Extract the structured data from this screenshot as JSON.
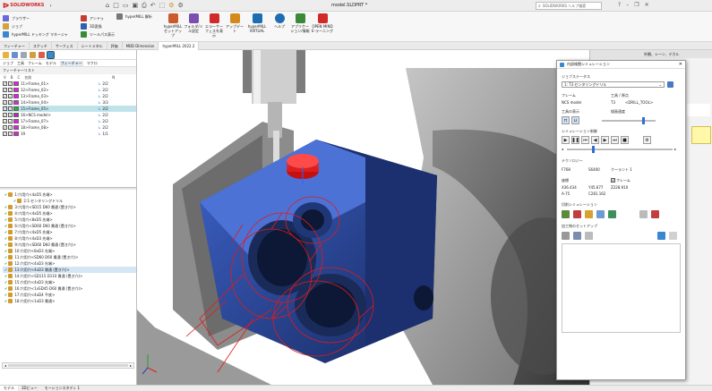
{
  "app": {
    "name": "SOLIDWORKS",
    "doc_title": "model.SLDPRT *",
    "search_placeholder": "SOLIDWORKS ヘルプ検索",
    "brand_color": "#d22027"
  },
  "quickmenu": [
    "ブラウザー",
    "ジョブ",
    "hyperMILL ドッキング マネージャ"
  ],
  "ribbon": [
    {
      "label": "アンドゥ",
      "color": "#c63b2f"
    },
    {
      "label": "3D変換",
      "color": "#2d5fb4"
    },
    {
      "label": "ツールパス表示",
      "color": "#3a8a3a"
    },
    {
      "label": "hyperMILL 解析",
      "color": "#555555"
    },
    {
      "label": "hyperMILL セットアップ",
      "color": "#cc5a2a"
    },
    {
      "label": "フォルダ/ミル設定",
      "color": "#7a4fb0"
    },
    {
      "label": "エラーサーフェスを表示",
      "color": "#d12a2a"
    },
    {
      "label": "アップデート",
      "color": "#d48a1a"
    },
    {
      "label": "hyperMILL VIRTUAL",
      "color": "#1e6db3"
    },
    {
      "label": "ヘルプ",
      "color": "#1e6db3"
    },
    {
      "label": "アプリケーション/情報",
      "color": "#3a8a3a"
    },
    {
      "label": "OPEN MIND E-ラーニング",
      "color": "#d12a2a"
    }
  ],
  "cmd_tabs": [
    "フィーチャー",
    "スケッチ",
    "サーフェス",
    "シートメタル",
    "評価",
    "MBD Dimension",
    "hyperMILL 2022.2"
  ],
  "browser": {
    "tabs": [
      "ジョブ",
      "工具",
      "フレーム",
      "モデル",
      "フィーチャー",
      "マクロ"
    ],
    "section": "フィーチャーリスト",
    "cols": [
      "V",
      "B",
      "C",
      "名前",
      "N"
    ],
    "frames": [
      {
        "name": "11>Frame_01>",
        "n": "2/2",
        "color": "#e81ce8"
      },
      {
        "name": "12>Frame_02>",
        "n": "2/2",
        "color": "#e81ce8"
      },
      {
        "name": "13>Frame_03>",
        "n": "2/2",
        "color": "#e81ce8"
      },
      {
        "name": "14>Frame_04>",
        "n": "3/3",
        "color": "#e81ce8"
      },
      {
        "name": "15>Frame_05>",
        "n": "2/2",
        "color": "#3aa33a",
        "selected": true
      },
      {
        "name": "16>NCS model>",
        "n": "2/2",
        "color": "#9a3b9e"
      },
      {
        "name": "17>Frame_07>",
        "n": "2/2",
        "color": "#e81ce8"
      },
      {
        "name": "18>Frame_08>",
        "n": "2/2",
        "color": "#e81ce8"
      },
      {
        "name": "19",
        "n": "1/1",
        "color": "#e81ce8"
      }
    ],
    "jobs": [
      "1:穴用穴<4xD5 先端>",
      "2:1:センタリングドリル",
      "3:穴用穴<SD15 D60 貫通 (置き穴)>",
      "4:穴用穴<4xD5 先端>",
      "5:穴用穴<8xD5 先端>",
      "6:穴用穴<SD60 D60 貫通 (置き穴)>",
      "7:穴用穴<4xD5 先端>",
      "8:穴用穴<4xD3 先端>",
      "9:穴用穴<SD60 D60 貫通 (置き穴)>",
      "10:穴用穴<8xD3 先端>",
      "11:穴用穴<SD60 D60 貫通 (置き穴)>",
      "12:穴用穴<4xD3 先端>",
      "13:穴用穴<4xD3 貫通 (置き穴)>",
      "14:穴用穴<SD115 D110 貫通 (置き穴)>",
      "15:穴用穴<4xD3 先端>",
      "16:穴用穴<1xSD45 D60 貫通 (置き穴)>",
      "17:穴用穴<4xD4 平底>",
      "18:穴用穴<1xD3 貫通>"
    ]
  },
  "dialog": {
    "title": "内部検閲シミュレーション",
    "job_status_label": "ジョブステータス",
    "job_status_value": "1: T3 センタリングドリル",
    "frame_label": "フレーム",
    "frame_value": "NCS model",
    "tool_label": "工具 / 原点",
    "tool_value": "T3",
    "tool_value2": "<DRILL_TOOL>",
    "tool_display_label": "工具の表示",
    "speed_label": "描画速度",
    "sim_control_label": "シミュレーション制御",
    "tech_label": "テクノロジー",
    "feed": "F768",
    "spindle": "S6400",
    "coolant": "クーラント 1",
    "coords_label": "座標",
    "frame_check": "フレーム",
    "x": "X36.434",
    "y": "Y45.677",
    "z": "Z228.910",
    "a": "A-75",
    "c": "C281.162",
    "cut_sim_label": "切削シミュレーション",
    "setup_label": "加工物のセットアップ"
  },
  "rightpanel": {
    "title": "外観、シーン、デカル"
  },
  "status": {
    "tabs": [
      "モデル",
      "3Dビュー",
      "モーションスタディ 1"
    ]
  }
}
